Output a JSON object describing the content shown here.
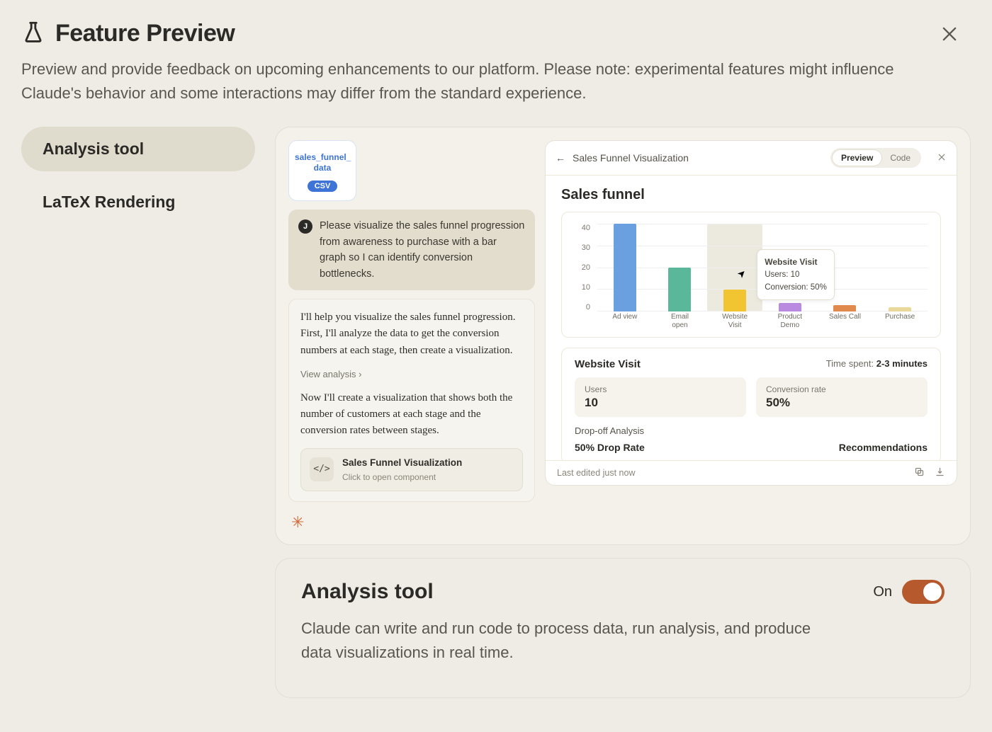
{
  "header": {
    "title": "Feature Preview",
    "subtitle": "Preview and provide feedback on upcoming enhancements to our platform. Please note: experimental features might influence Claude's behavior and some interactions may differ from the standard experience."
  },
  "sidebar": {
    "items": [
      {
        "label": "Analysis tool",
        "active": true
      },
      {
        "label": "LaTeX Rendering",
        "active": false
      }
    ]
  },
  "chat": {
    "file": {
      "name": "sales_funnel_\ndata",
      "badge": "CSV"
    },
    "user_avatar": "J",
    "user_msg": "Please visualize the sales funnel progression from awareness to purchase with a bar graph so I can identify conversion bottlenecks.",
    "assist_p1": "I'll help you visualize the sales funnel progression. First, I'll analyze the data to get the conversion numbers at each stage, then create a visualization.",
    "view_analysis": "View analysis",
    "assist_p2": "Now I'll create a visualization that shows both the number of customers at each stage and the conversion rates between stages.",
    "component": {
      "title": "Sales Funnel Visualization",
      "sub": "Click to open component"
    }
  },
  "artifact": {
    "back_title": "Sales Funnel Visualization",
    "tabs": {
      "preview": "Preview",
      "code": "Code"
    },
    "chart_title": "Sales funnel",
    "tooltip": {
      "title": "Website Visit",
      "l1": "Users: 10",
      "l2": "Conversion: 50%"
    },
    "detail": {
      "title": "Website Visit",
      "time_label": "Time spent:",
      "time_value": "2-3 minutes",
      "users_label": "Users",
      "users_value": "10",
      "conv_label": "Conversion rate",
      "conv_value": "50%",
      "drop_label": "Drop-off Analysis",
      "drop_rate": "50% Drop Rate",
      "recs": "Recommendations"
    },
    "footer": "Last edited just now"
  },
  "chart_data": {
    "type": "bar",
    "title": "Sales funnel",
    "ylim": [
      0,
      40
    ],
    "yticks": [
      0,
      10,
      20,
      30,
      40
    ],
    "categories": [
      "Ad view",
      "Email open",
      "Website Visit",
      "Product Demo",
      "Sales Call",
      "Purchase"
    ],
    "values": [
      40,
      20,
      10,
      4,
      3,
      2
    ],
    "colors": [
      "#6a9fe0",
      "#5ab79a",
      "#f1c431",
      "#b98adf",
      "#e18a4e",
      "#e8d99a"
    ],
    "highlight_index": 2,
    "tooltip": {
      "category": "Website Visit",
      "users": 10,
      "conversion": "50%"
    }
  },
  "toggle": {
    "title": "Analysis tool",
    "state_label": "On",
    "enabled": true,
    "description": "Claude can write and run code to process data, run analysis, and produce data visualizations in real time."
  }
}
